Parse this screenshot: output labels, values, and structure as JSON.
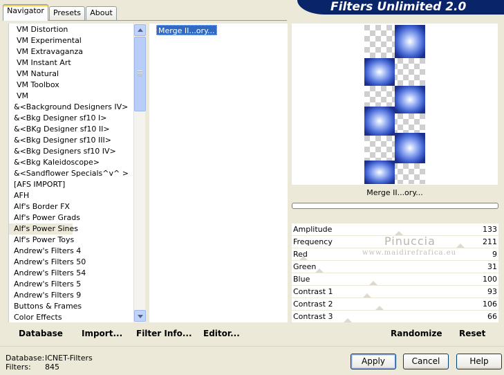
{
  "tabs": [
    {
      "label": "Navigator",
      "active": true
    },
    {
      "label": "Presets",
      "active": false
    },
    {
      "label": "About",
      "active": false
    }
  ],
  "banner": {
    "title": "Filters Unlimited 2.0",
    "color": "#0a246a"
  },
  "categories": {
    "items": [
      "VM Distortion",
      "VM Experimental",
      "VM Extravaganza",
      "VM Instant Art",
      "VM Natural",
      "VM Toolbox",
      "VM",
      "&<Background Designers IV>",
      "&<Bkg Designer sf10 I>",
      "&<BKg Designer sf10 II>",
      "&<Bkg Designer sf10 III>",
      "&<Bkg Designers sf10 IV>",
      "&<Bkg Kaleidoscope>",
      "&<Sandflower Specials^v^ >",
      "[AFS IMPORT]",
      "AFH",
      "Alf's Border FX",
      "Alf's Power Grads",
      "Alf's Power Sines",
      "Alf's Power Toys",
      "Andrew's Filters 4",
      "Andrew's Filters 50",
      "Andrew's Filters 54",
      "Andrew's Filters 5",
      "Andrew's Filters 9",
      "Buttons & Frames",
      "Color Effects"
    ],
    "selected": "Alf's Power Sines"
  },
  "filters": {
    "items": [
      "Merge II...ory..."
    ],
    "selected": "Merge II...ory..."
  },
  "preview": {
    "filter_name": "Merge II...ory...",
    "progress": 0,
    "accent": "#3d5fcf"
  },
  "params": [
    {
      "label": "Amplitude",
      "value": "133",
      "level": 0.52
    },
    {
      "label": "Frequency",
      "value": "211",
      "level": 0.83
    },
    {
      "label": "Red",
      "value": "9",
      "level": 0.04
    },
    {
      "label": "Green",
      "value": "31",
      "level": 0.12
    },
    {
      "label": "Blue",
      "value": "100",
      "level": 0.39
    },
    {
      "label": "Contrast 1",
      "value": "93",
      "level": 0.36
    },
    {
      "label": "Contrast 2",
      "value": "106",
      "level": 0.42
    },
    {
      "label": "Contrast 3",
      "value": "66",
      "level": 0.26
    }
  ],
  "watermark": {
    "line1": "Pinuccia",
    "line2": "www.maidirefrafica.eu"
  },
  "left_buttons": {
    "database": "Database",
    "import": "Import...",
    "filter_info": "Filter Info...",
    "editor": "Editor..."
  },
  "right_buttons": {
    "randomize": "Randomize",
    "reset": "Reset"
  },
  "status": {
    "database_label": "Database:",
    "database_value": "ICNET-Filters",
    "filters_label": "Filters:",
    "filters_value": "845"
  },
  "dialog_buttons": {
    "apply": "Apply",
    "cancel": "Cancel",
    "help": "Help"
  }
}
